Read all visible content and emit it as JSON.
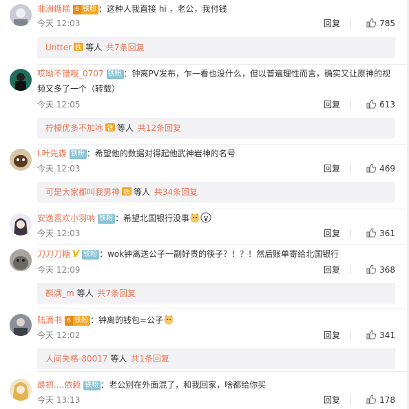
{
  "colors": {
    "username": "#eb7350",
    "meta": "#808080",
    "subbg": "#f2f2f5",
    "iron_badge": "#89c3d6",
    "gold_badge": "#f5a623"
  },
  "reply_label": "回复",
  "comments": [
    {
      "user": "非洲糖糕",
      "badge": "铁粉",
      "badge_type": "gold",
      "badge_level": "6",
      "text": "：这种人我直接 hi ，老公，我付钱",
      "time": "今天 12:03",
      "likes": "785",
      "sub": {
        "name": "Untter",
        "mid": "等人",
        "more": "共7条回复"
      }
    },
    {
      "user": "哎呦不错哦_0707",
      "badge": "铁粉",
      "badge_type": "iron",
      "text": "：钟离PV发布，乍一看也没什么，但以普遍理性而言，确实又让原神的视频又多了一个（转载）",
      "time": "今天 12:05",
      "likes": "613",
      "sub": {
        "name": "柠檬优多不加冰",
        "mid": "等人",
        "more": "共12条回复"
      }
    },
    {
      "user": "L叶先森",
      "badge": "铁粉",
      "badge_type": "iron",
      "text": "：希望他的数据对得起他武神岩神的名号",
      "time": "今天 12:03",
      "likes": "469",
      "sub": {
        "name": "可是大家都叫我男神",
        "mid": "等人",
        "more": "共34条回复"
      }
    },
    {
      "user": "安逸喜欢小羽呐",
      "badge": "铁粉",
      "badge_type": "iron",
      "text": "：希望北国银行没事",
      "time": "今天 12:03",
      "likes": "361"
    },
    {
      "user": "刀刀刀糖",
      "badge": "铁粉",
      "badge_type": "iron",
      "vip": "V",
      "text": "：wok钟离送公子一副好贵的筷子？！？！然后账单寄给北国银行",
      "time": "今天 12:09",
      "likes": "368",
      "sub": {
        "name": "斟满_m",
        "mid": "等人",
        "more": "共7条回复"
      }
    },
    {
      "user": "陆滴书",
      "badge": "铁粉",
      "badge_type": "gold",
      "badge_level": "6",
      "text": "：钟离的钱包=公子",
      "time": "今天 12:02",
      "likes": "341",
      "sub": {
        "name": "人间失格-80017",
        "mid": "等人",
        "more": "共1条回复"
      }
    },
    {
      "user": "最初....依赖",
      "badge": "铁粉",
      "badge_type": "iron",
      "text": "：老公别在外面混了，和我回家，啥都给你买",
      "time": "今天 13:13",
      "likes": "178"
    }
  ]
}
